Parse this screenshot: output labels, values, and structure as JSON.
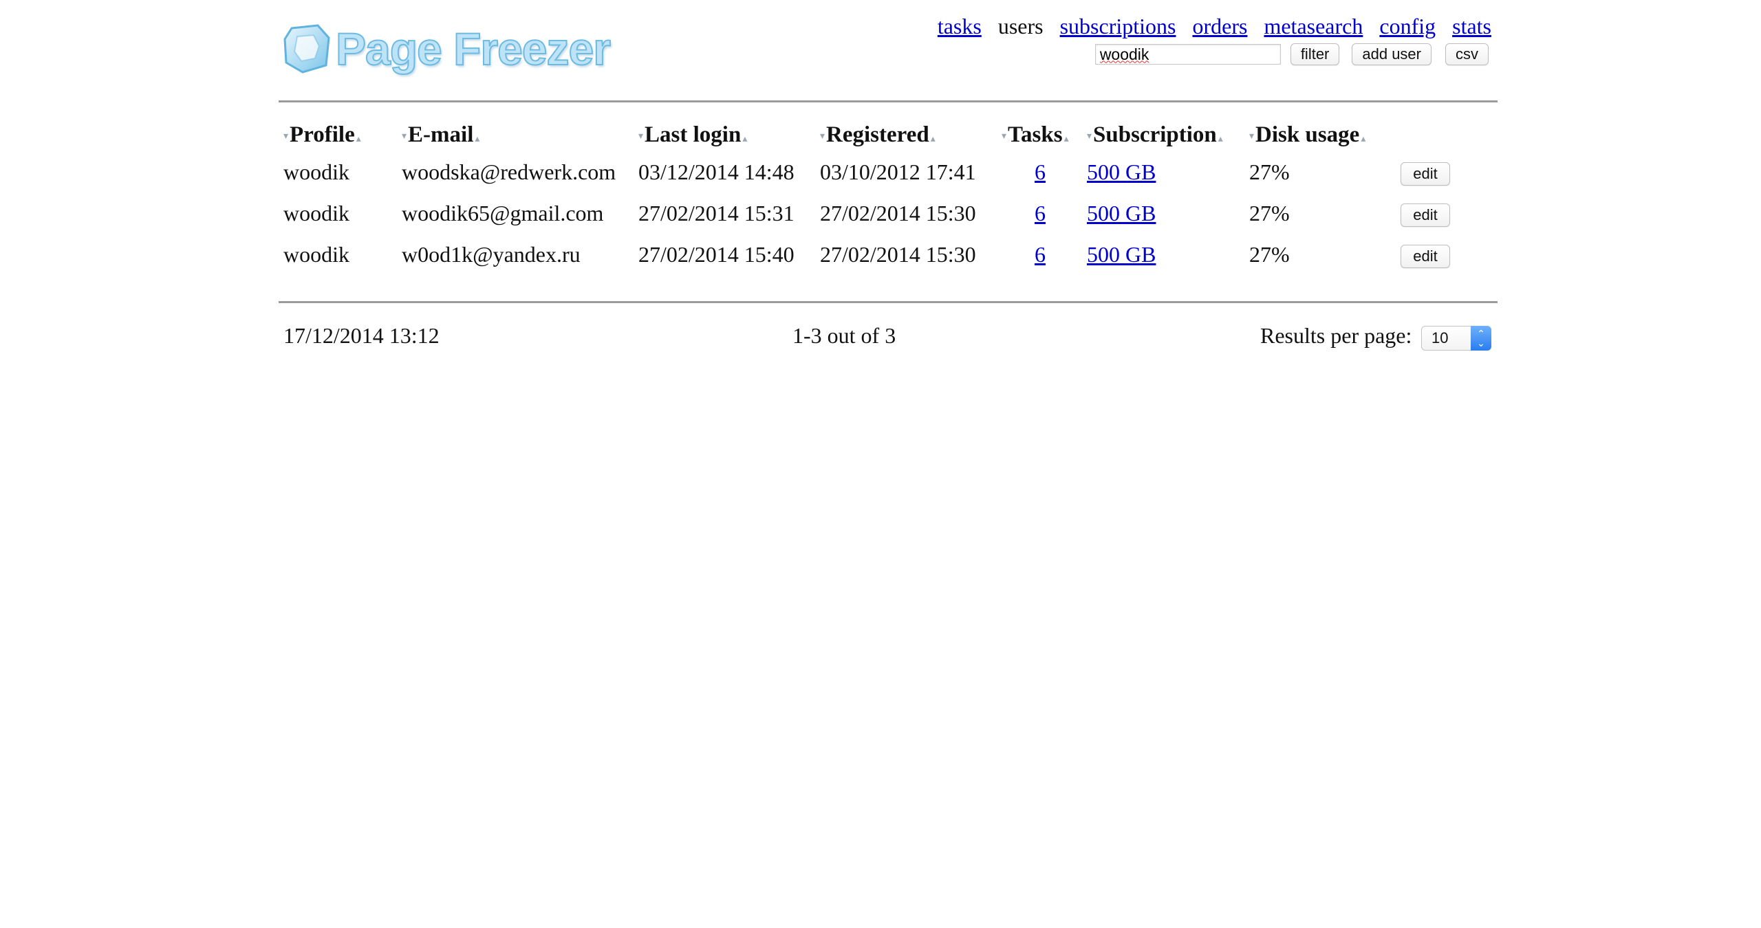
{
  "brand": {
    "logo_text": "Page Freezer"
  },
  "nav": {
    "items": [
      {
        "label": "tasks",
        "current": false
      },
      {
        "label": "users",
        "current": true
      },
      {
        "label": "subscriptions",
        "current": false
      },
      {
        "label": "orders",
        "current": false
      },
      {
        "label": "metasearch",
        "current": false
      },
      {
        "label": "config",
        "current": false
      },
      {
        "label": "stats",
        "current": false
      }
    ]
  },
  "toolbar": {
    "search_value": "woodik",
    "filter_label": "filter",
    "add_user_label": "add user",
    "csv_label": "csv"
  },
  "table": {
    "columns": [
      "Profile",
      "E-mail",
      "Last login",
      "Registered",
      "Tasks",
      "Subscription",
      "Disk usage"
    ],
    "rows": [
      {
        "profile": "woodik",
        "email": "woodska@redwerk.com",
        "last_login": "03/12/2014 14:48",
        "registered": "03/10/2012 17:41",
        "tasks": "6",
        "subscription": "500 GB",
        "disk_usage": "27%",
        "action": "edit"
      },
      {
        "profile": "woodik",
        "email": "woodik65@gmail.com",
        "last_login": "27/02/2014 15:31",
        "registered": "27/02/2014 15:30",
        "tasks": "6",
        "subscription": "500 GB",
        "disk_usage": "27%",
        "action": "edit"
      },
      {
        "profile": "woodik",
        "email": "w0od1k@yandex.ru",
        "last_login": "27/02/2014 15:40",
        "registered": "27/02/2014 15:30",
        "tasks": "6",
        "subscription": "500 GB",
        "disk_usage": "27%",
        "action": "edit"
      }
    ],
    "sort_arrow_down": "▾",
    "sort_arrow_up": "▴"
  },
  "footer": {
    "timestamp": "17/12/2014 13:12",
    "pagination": "1-3 out of 3",
    "results_per_page_label": "Results per page:",
    "results_per_page_value": "10"
  },
  "colors": {
    "link": "#0000cc",
    "divider": "#9a9a9a",
    "logo": "#6bbbe2"
  }
}
